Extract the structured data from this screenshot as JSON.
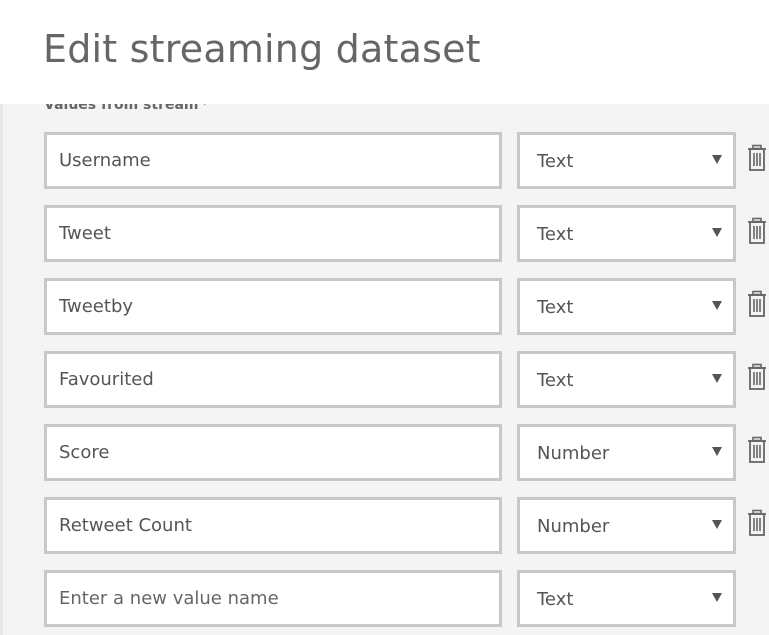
{
  "dialog": {
    "title": "Edit streaming dataset"
  },
  "values_section": {
    "label": "Values from stream",
    "required_marker": "*"
  },
  "rows": [
    {
      "name": "Username",
      "type": "Text",
      "deletable": true
    },
    {
      "name": "Tweet",
      "type": "Text",
      "deletable": true
    },
    {
      "name": "Tweetby",
      "type": "Text",
      "deletable": true
    },
    {
      "name": "Favourited",
      "type": "Text",
      "deletable": true
    },
    {
      "name": "Score",
      "type": "Number",
      "deletable": true
    },
    {
      "name": "Retweet Count",
      "type": "Number",
      "deletable": true
    }
  ],
  "new_row": {
    "name": "",
    "placeholder": "Enter a new value name",
    "type": "Text"
  },
  "icons": {
    "delete": "trash-icon",
    "dropdown": "chevron-down-icon"
  },
  "colors": {
    "border": "#c8c8c8",
    "panel_bg": "#f4f4f4",
    "required": "#e81123",
    "title": "#666666"
  }
}
